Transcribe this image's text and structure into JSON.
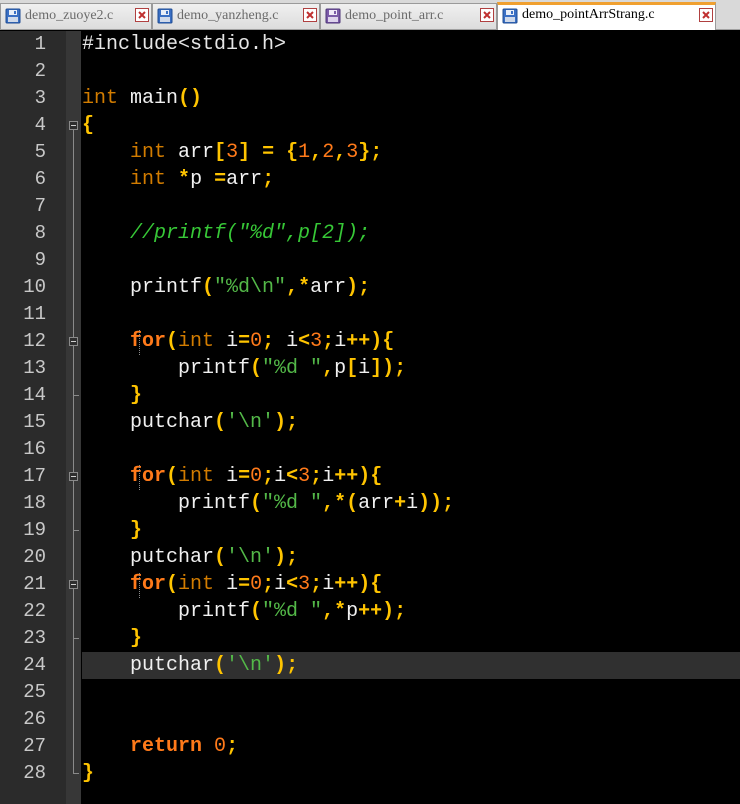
{
  "tabs": [
    {
      "label": "demo_zuoye2.c",
      "active": false,
      "icon": "floppy-disk-icon"
    },
    {
      "label": "demo_yanzheng.c",
      "active": false,
      "icon": "floppy-disk-icon"
    },
    {
      "label": "demo_point_arr.c",
      "active": false,
      "icon": "floppy-disk-icon"
    },
    {
      "label": "demo_pointArrStrang.c",
      "active": true,
      "icon": "floppy-disk-icon"
    }
  ],
  "editor": {
    "current_line": 24,
    "line_numbers": [
      "1",
      "2",
      "3",
      "4",
      "5",
      "6",
      "7",
      "8",
      "9",
      "10",
      "11",
      "12",
      "13",
      "14",
      "15",
      "16",
      "17",
      "18",
      "19",
      "20",
      "21",
      "22",
      "23",
      "24",
      "25",
      "26",
      "27",
      "28"
    ],
    "lines": [
      [
        [
          "pp",
          "#include<stdio.h>"
        ]
      ],
      [],
      [
        [
          "kw",
          "int"
        ],
        [
          "id",
          " main"
        ],
        [
          "op",
          "()"
        ]
      ],
      [
        [
          "op",
          "{"
        ]
      ],
      [
        [
          "id",
          "    "
        ],
        [
          "kw",
          "int"
        ],
        [
          "id",
          " arr"
        ],
        [
          "op",
          "["
        ],
        [
          "num",
          "3"
        ],
        [
          "op",
          "]"
        ],
        [
          "id",
          " "
        ],
        [
          "op",
          "="
        ],
        [
          "id",
          " "
        ],
        [
          "op",
          "{"
        ],
        [
          "num",
          "1"
        ],
        [
          "op",
          ","
        ],
        [
          "num",
          "2"
        ],
        [
          "op",
          ","
        ],
        [
          "num",
          "3"
        ],
        [
          "op",
          "};"
        ]
      ],
      [
        [
          "id",
          "    "
        ],
        [
          "kw",
          "int"
        ],
        [
          "id",
          " "
        ],
        [
          "op",
          "*"
        ],
        [
          "id",
          "p "
        ],
        [
          "op",
          "="
        ],
        [
          "id",
          "arr"
        ],
        [
          "op",
          ";"
        ]
      ],
      [],
      [
        [
          "id",
          "    "
        ],
        [
          "cmt",
          "//printf(\"%d\",p[2]);"
        ]
      ],
      [],
      [
        [
          "id",
          "    printf"
        ],
        [
          "op",
          "("
        ],
        [
          "str",
          "\"%d\\n\""
        ],
        [
          "op",
          ","
        ],
        [
          "op",
          "*"
        ],
        [
          "id",
          "arr"
        ],
        [
          "op",
          ");"
        ]
      ],
      [],
      [
        [
          "id",
          "    "
        ],
        [
          "kwb",
          "for"
        ],
        [
          "op",
          "("
        ],
        [
          "kw",
          "int"
        ],
        [
          "id",
          " i"
        ],
        [
          "op",
          "="
        ],
        [
          "num",
          "0"
        ],
        [
          "op",
          ";"
        ],
        [
          "id",
          " i"
        ],
        [
          "op",
          "<"
        ],
        [
          "num",
          "3"
        ],
        [
          "op",
          ";"
        ],
        [
          "id",
          "i"
        ],
        [
          "op",
          "++){"
        ]
      ],
      [
        [
          "id",
          "        printf"
        ],
        [
          "op",
          "("
        ],
        [
          "str",
          "\"%d \""
        ],
        [
          "op",
          ","
        ],
        [
          "id",
          "p"
        ],
        [
          "op",
          "["
        ],
        [
          "id",
          "i"
        ],
        [
          "op",
          "]);"
        ]
      ],
      [
        [
          "id",
          "    "
        ],
        [
          "op",
          "}"
        ]
      ],
      [
        [
          "id",
          "    putchar"
        ],
        [
          "op",
          "("
        ],
        [
          "str",
          "'\\n'"
        ],
        [
          "op",
          ");"
        ]
      ],
      [],
      [
        [
          "id",
          "    "
        ],
        [
          "kwb",
          "for"
        ],
        [
          "op",
          "("
        ],
        [
          "kw",
          "int"
        ],
        [
          "id",
          " i"
        ],
        [
          "op",
          "="
        ],
        [
          "num",
          "0"
        ],
        [
          "op",
          ";"
        ],
        [
          "id",
          "i"
        ],
        [
          "op",
          "<"
        ],
        [
          "num",
          "3"
        ],
        [
          "op",
          ";"
        ],
        [
          "id",
          "i"
        ],
        [
          "op",
          "++){"
        ]
      ],
      [
        [
          "id",
          "        printf"
        ],
        [
          "op",
          "("
        ],
        [
          "str",
          "\"%d \""
        ],
        [
          "op",
          ","
        ],
        [
          "op",
          "*("
        ],
        [
          "id",
          "arr"
        ],
        [
          "op",
          "+"
        ],
        [
          "id",
          "i"
        ],
        [
          "op",
          "));"
        ]
      ],
      [
        [
          "id",
          "    "
        ],
        [
          "op",
          "}"
        ]
      ],
      [
        [
          "id",
          "    putchar"
        ],
        [
          "op",
          "("
        ],
        [
          "str",
          "'\\n'"
        ],
        [
          "op",
          ");"
        ]
      ],
      [
        [
          "id",
          "    "
        ],
        [
          "kwb",
          "for"
        ],
        [
          "op",
          "("
        ],
        [
          "kw",
          "int"
        ],
        [
          "id",
          " i"
        ],
        [
          "op",
          "="
        ],
        [
          "num",
          "0"
        ],
        [
          "op",
          ";"
        ],
        [
          "id",
          "i"
        ],
        [
          "op",
          "<"
        ],
        [
          "num",
          "3"
        ],
        [
          "op",
          ";"
        ],
        [
          "id",
          "i"
        ],
        [
          "op",
          "++){"
        ]
      ],
      [
        [
          "id",
          "        printf"
        ],
        [
          "op",
          "("
        ],
        [
          "str",
          "\"%d \""
        ],
        [
          "op",
          ","
        ],
        [
          "op",
          "*"
        ],
        [
          "id",
          "p"
        ],
        [
          "op",
          "++);"
        ]
      ],
      [
        [
          "id",
          "    "
        ],
        [
          "op",
          "}"
        ]
      ],
      [
        [
          "id",
          "    putchar"
        ],
        [
          "op",
          "("
        ],
        [
          "str",
          "'\\n'"
        ],
        [
          "op",
          ");"
        ]
      ],
      [],
      [],
      [
        [
          "id",
          "    "
        ],
        [
          "kwb",
          "return"
        ],
        [
          "id",
          " "
        ],
        [
          "num",
          "0"
        ],
        [
          "op",
          ";"
        ]
      ],
      [
        [
          "op",
          "}"
        ]
      ]
    ]
  },
  "colors": {
    "background": "#000000",
    "gutter": "#2b2b2b",
    "active_tab_accent": "#f0a030"
  }
}
